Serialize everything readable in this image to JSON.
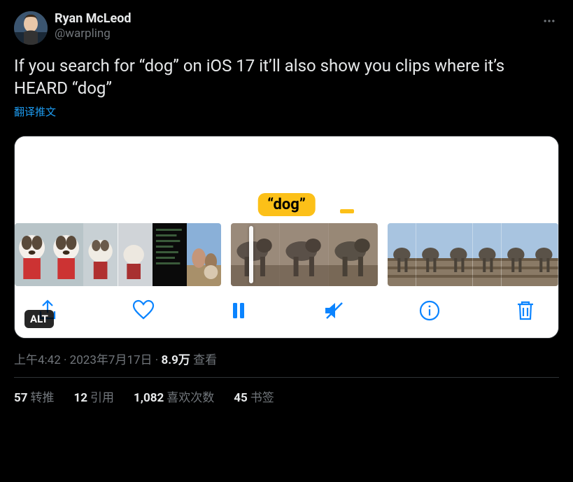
{
  "user": {
    "display_name": "Ryan McLeod",
    "handle": "@warpling"
  },
  "tweet": {
    "text": "If you search for “dog” on iOS 17 it’ll also show you clips where it’s HEARD “dog”",
    "translate_link": "翻译推文"
  },
  "media": {
    "search_tag": "“dog”",
    "alt_badge": "ALT"
  },
  "meta": {
    "time": "上午4:42",
    "date": "2023年7月17日",
    "views_count": "8.9万",
    "views_label": " 查看"
  },
  "stats": {
    "retweets_count": "57",
    "retweets_label": "转推",
    "quotes_count": "12",
    "quotes_label": "引用",
    "likes_count": "1,082",
    "likes_label": "喜欢次数",
    "bookmarks_count": "45",
    "bookmarks_label": "书签"
  }
}
